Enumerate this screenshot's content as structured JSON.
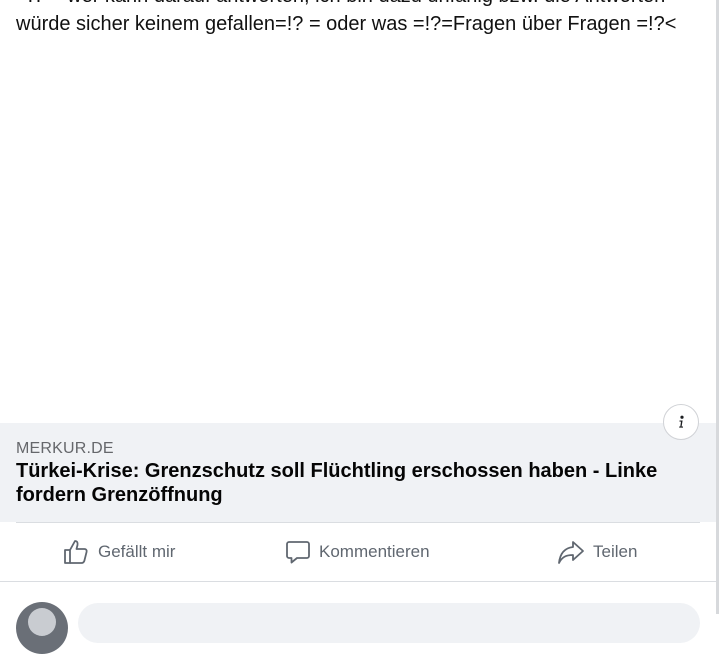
{
  "post": {
    "text_lines": [
      "=!? = wer kann darauf antworten, ich bin dazu unfähig bzw. die Antworten",
      "würde sicher keinem gefallen=!? = oder was =!?=Fragen über Fragen =!?<"
    ]
  },
  "link_preview": {
    "domain": "MERKUR.DE",
    "title": "Türkei-Krise: Grenzschutz soll Flüchtling erschossen haben - Linke fordern Grenzöffnung",
    "info_icon": "info-icon"
  },
  "actions": {
    "like_label": "Gefällt mir",
    "comment_label": "Kommentieren",
    "share_label": "Teilen",
    "like_icon": "thumbs-up-icon",
    "comment_icon": "speech-bubble-icon",
    "share_icon": "share-arrow-icon"
  },
  "colors": {
    "preview_background": "#f0f2f5",
    "action_text": "#606770"
  }
}
